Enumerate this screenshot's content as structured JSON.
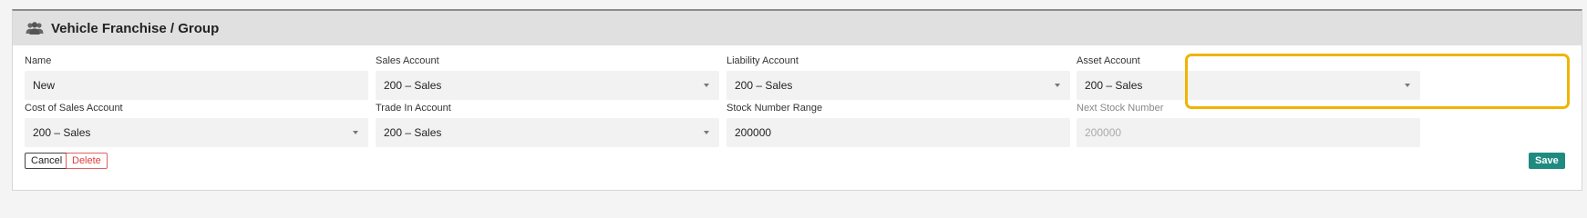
{
  "panel": {
    "title": "Vehicle Franchise / Group",
    "icon": "users-icon"
  },
  "fields": {
    "name": {
      "label": "Name",
      "value": "New"
    },
    "sales_account": {
      "label": "Sales Account",
      "value": "200 – Sales"
    },
    "liability_account": {
      "label": "Liability Account",
      "value": "200 – Sales"
    },
    "asset_account": {
      "label": "Asset Account",
      "value": "200 – Sales"
    },
    "cost_of_sales_account": {
      "label": "Cost of Sales Account",
      "value": "200 – Sales"
    },
    "trade_in_account": {
      "label": "Trade In Account",
      "value": "200 – Sales"
    },
    "stock_number_range": {
      "label": "Stock Number Range",
      "value": "200000"
    },
    "next_stock_number": {
      "label": "Next Stock Number",
      "value": "200000"
    }
  },
  "buttons": {
    "cancel": "Cancel",
    "delete": "Delete",
    "save": "Save"
  },
  "colors": {
    "highlight": "#f0b400",
    "save": "#1f8a80",
    "delete": "#e03c3c"
  }
}
